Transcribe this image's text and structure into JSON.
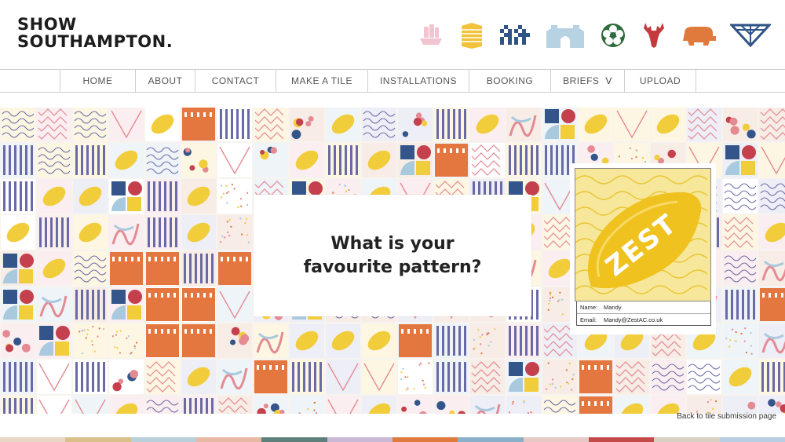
{
  "header": {
    "logo_line1": "SHOW",
    "logo_line2": "SOUTHAMPTON.",
    "icons": [
      "ship-icon",
      "stacked-stripes-icon",
      "blue-pixel-houses-icon",
      "bargate-icon",
      "rose-icon",
      "stag-head-icon",
      "orange-turtle-icon",
      "inverted-triangle-icon"
    ]
  },
  "nav": {
    "items": [
      {
        "label": "HOME"
      },
      {
        "label": "ABOUT"
      },
      {
        "label": "CONTACT"
      },
      {
        "label": "MAKE A TILE"
      },
      {
        "label": "INSTALLATIONS"
      },
      {
        "label": "BOOKING"
      },
      {
        "label": "BRIEFS",
        "dropdown": "V"
      },
      {
        "label": "UPLOAD"
      }
    ]
  },
  "main": {
    "question": "What is your favourite pattern?",
    "tile": {
      "word": "ZEST",
      "name_label": "Name:",
      "name_value": "Mandy",
      "email_label": "Email:",
      "email_value": "Mandy@ZestAC.co.uk"
    },
    "back_link": "Back to tile submission page"
  },
  "colors": {
    "purple": "#6a6aa6",
    "pink": "#e48a93",
    "orange": "#e3773f",
    "yellow": "#f2cd3b",
    "navy": "#33558a",
    "red": "#c4404d",
    "sky": "#a9c9de",
    "cream": "#f6efe0"
  }
}
